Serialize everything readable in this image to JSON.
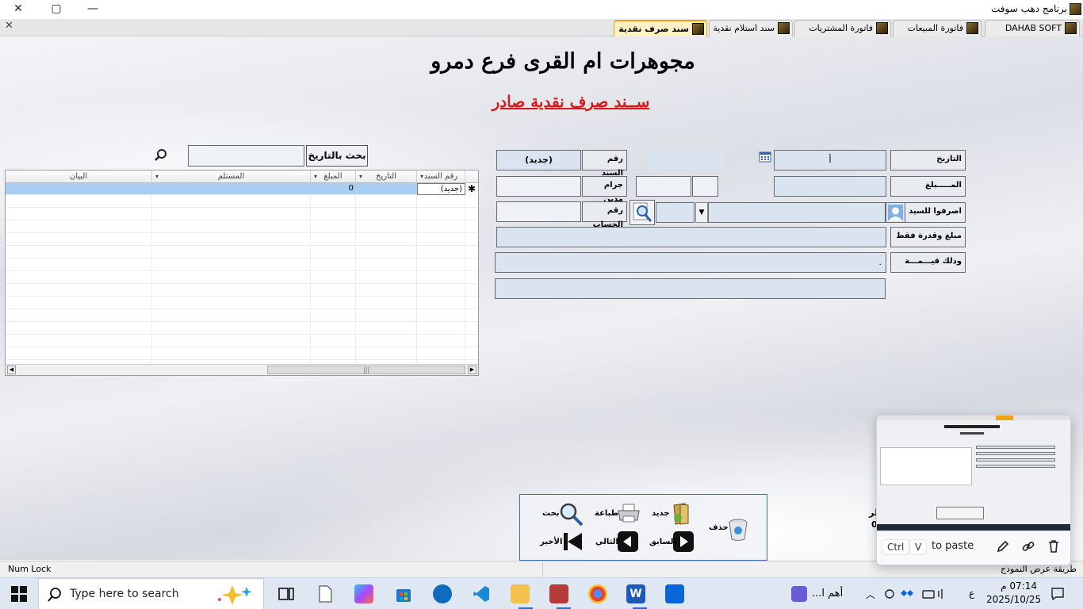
{
  "window": {
    "title": "برنامج دهب سوفت",
    "minimize": "—",
    "maximize": "▢",
    "close": "✕"
  },
  "tabs": [
    {
      "label": "DAHAB SOFT"
    },
    {
      "label": "فاتورة المبيعات"
    },
    {
      "label": "فاتورة المشتريات"
    },
    {
      "label": "سند استلام نقدية"
    },
    {
      "label": "سند صرف نقدية",
      "active": true
    }
  ],
  "tab_close": "✕",
  "header": {
    "company": "مجوهرات ام القرى فرع دمرو",
    "doc_title": "ســند صرف نقدية    صادر"
  },
  "form": {
    "date_label": "التاريخ",
    "date_value": "أ",
    "amount_label": "المـــــبلغ",
    "voucher_no_label": "رقم السند",
    "voucher_no_value": "(جديد)",
    "grams_label": "جرام مدين",
    "pay_to_label": "اصرفوا للسيد",
    "account_no_label": "رقم الحساب",
    "amount_words_label": "مبلغ وقدرة فقط",
    "value_label": "وذلك قيـــمـــة",
    "value_field": "."
  },
  "search": {
    "button_label": "بحث بالتاريخ",
    "input_value": ""
  },
  "grid": {
    "columns": [
      "رقم السند",
      "التاريخ",
      "المبلغ",
      "المستلم",
      "البيان"
    ],
    "new_row": {
      "voucher": "(جديد)",
      "date": "",
      "amount": "0",
      "receiver": "",
      "statement": ""
    },
    "new_row_marker": "✱"
  },
  "toolbar": {
    "delete": "حذف",
    "new": "جديد",
    "print": "طباعة",
    "search": "بحث",
    "previous": "السابق",
    "next": "التالي",
    "last": "الأخير"
  },
  "side_fragment": {
    "a": "ظر",
    "b": "0"
  },
  "statusbar": {
    "numlock": "Num Lock",
    "view_mode": "طريقة عرض النموذج"
  },
  "clipboard": {
    "ctrl": "Ctrl",
    "v": "V",
    "hint": "to paste"
  },
  "taskbar": {
    "search_placeholder": "Type here to search",
    "notification_text": "أهم ا...",
    "input_lang": "ع",
    "time": "07:14 م",
    "date": "2025/10/25"
  }
}
